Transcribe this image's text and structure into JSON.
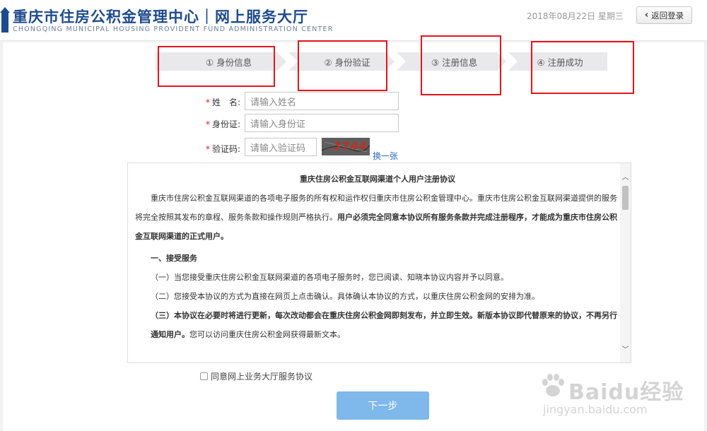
{
  "header": {
    "title": "重庆市住房公积金管理中心｜网上服务大厅",
    "subtitle": "CHONGQING MUNICIPAL HOUSING PROVIDENT FUND ADMINISTRATION CENTER",
    "date": "2018年08月22日 星期三",
    "back_label": "返回登录"
  },
  "steps": [
    {
      "label": "① 身份信息"
    },
    {
      "label": "② 身份验证"
    },
    {
      "label": "③ 注册信息"
    },
    {
      "label": "④ 注册成功"
    }
  ],
  "form": {
    "name_label": "姓　名:",
    "name_placeholder": "请输入姓名",
    "id_label": "身份证:",
    "id_placeholder": "请输入身份证",
    "code_label": "验证码:",
    "code_placeholder": "请输入验证码",
    "captcha_text": "3744",
    "refresh_label": "换一张"
  },
  "agreement": {
    "title": "重庆住房公积金互联网渠道个人用户注册协议",
    "intro": "重庆市住房公积金互联网渠道的各项电子服务的所有权和运作权归重庆市住房公积金管理中心。重庆市住房公积金互联网渠道提供的服务将完全按照其发布的章程、服务条款和操作规则严格执行。",
    "intro_bold": "用户必须完全同意本协议所有服务条款并完成注册程序，才能成为重庆市住房公积金互联网渠道的正式用户。",
    "section1": "一、接受服务",
    "item1": "（一）当您接受重庆住房公积金互联网渠道的各项电子服务时，您已阅读、知晓本协议内容并予以同意。",
    "item2": "（二）您接受本协议的方式为直接在网页上点击确认。具体确认本协议的方式，以重庆住房公积金网的安排为准。",
    "item3_bold": "（三）本协议在必要时将进行更新，每次改动都会在重庆住房公积金网即刻发布，并立即生效。新版本协议即代替原来的协议，不再另行通知用户。",
    "item3_tail": "您可以访问重庆住房公积金网获得最新文本。"
  },
  "agree_label": "同意网上业务大厅服务协议",
  "next_label": "下一步",
  "watermark": {
    "brand": "Baidu经验",
    "url": "jingyan.baidu.com"
  },
  "colors": {
    "brand": "#1e4b8f",
    "highlight": "#e8141b",
    "primary_button": "#7fb8ea",
    "link": "#2a6cc4"
  }
}
